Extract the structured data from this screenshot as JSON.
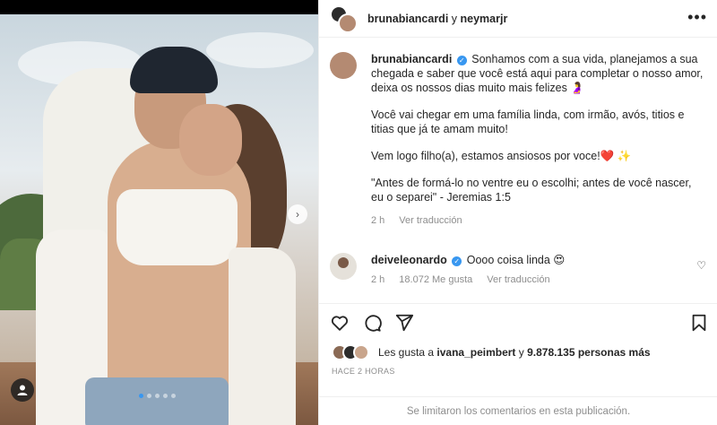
{
  "header": {
    "user1": "brunabiancardi",
    "joiner": "y",
    "user2": "neymarjr",
    "more_label": "•••"
  },
  "photo": {
    "next_glyph": "›",
    "dots_count": 5,
    "active_dot": 0
  },
  "caption": {
    "username": "brunabiancardi",
    "verified_glyph": "✓",
    "paragraph1": "Sonhamos com a sua vida, planejamos a sua chegada e saber que você está aqui para completar o nosso amor, deixa os nossos dias muito mais felizes 🤰",
    "paragraph2": "Você vai chegar em uma família linda, com irmão, avós, titios e titias que já te amam muito!",
    "paragraph3": "Vem logo filho(a), estamos ansiosos por voce!❤️ ✨",
    "paragraph4": "\"Antes de formá-lo no ventre eu o escolhi; antes de você nascer, eu o separei\" - Jeremias 1:5",
    "time": "2 h",
    "translate": "Ver traducción"
  },
  "comment": {
    "username": "deiveleonardo",
    "verified_glyph": "✓",
    "text": "Oooo coisa linda 😍",
    "time": "2 h",
    "likes": "18.072 Me gusta",
    "translate": "Ver traducción",
    "like_icon": "♡"
  },
  "actions": {
    "like_icon": "heart-icon",
    "comment_icon": "comment-icon",
    "share_icon": "send-icon",
    "save_icon": "bookmark-icon"
  },
  "likes": {
    "prefix": "Les gusta a ",
    "first_user": "ivana_peimbert",
    "middle": " y ",
    "others": "9.878.135 personas más"
  },
  "time_ago": "HACE 2 HORAS",
  "footer": "Se limitaron los comentarios en esta publicación.",
  "colors": {
    "accent": "#3897f0",
    "muted": "#8e8e8e",
    "text": "#262626",
    "border": "#efefef"
  }
}
